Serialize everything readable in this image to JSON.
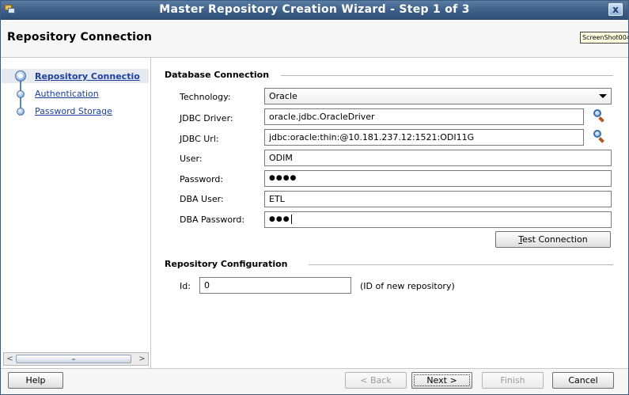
{
  "window": {
    "title": "Master Repository Creation Wizard - Step 1 of 3",
    "close_label": "x"
  },
  "header": {
    "title": "Repository Connection",
    "tooltip": "ScreenShot004"
  },
  "nav": {
    "items": [
      {
        "label": "Repository Connectio",
        "active": true
      },
      {
        "label": "Authentication",
        "active": false
      },
      {
        "label": "Password Storage",
        "active": false
      }
    ],
    "scroll": {
      "left_arrow": "<",
      "right_arrow": ">"
    }
  },
  "database_connection": {
    "title": "Database Connection",
    "technology": {
      "label": "Technology:",
      "value": "Oracle"
    },
    "jdbc_driver": {
      "label": "JDBC Driver:",
      "value": "oracle.jdbc.OracleDriver"
    },
    "jdbc_url": {
      "label": "JDBC Url:",
      "value": "jdbc:oracle:thin:@10.181.237.12:1521:ODI11G"
    },
    "user": {
      "label": "User:",
      "value": "ODIM"
    },
    "password": {
      "label": "Password:",
      "value": "●●●●"
    },
    "dba_user": {
      "label": "DBA User:",
      "value": "ETL"
    },
    "dba_password": {
      "label": "DBA Password:",
      "value": "●●●"
    },
    "test_connection": {
      "mnemonic": "T",
      "rest": "est Connection"
    }
  },
  "repository_configuration": {
    "title": "Repository Configuration",
    "id": {
      "label": "Id:",
      "value": "0",
      "hint": "(ID of new repository)"
    }
  },
  "footer": {
    "help": "Help",
    "back": "< Back",
    "next": "Next >",
    "finish": "Finish",
    "cancel": "Cancel"
  },
  "colors": {
    "titlebar": "#3e6088",
    "link": "#1a3f9e",
    "tooltip_bg": "#ffffe1"
  }
}
